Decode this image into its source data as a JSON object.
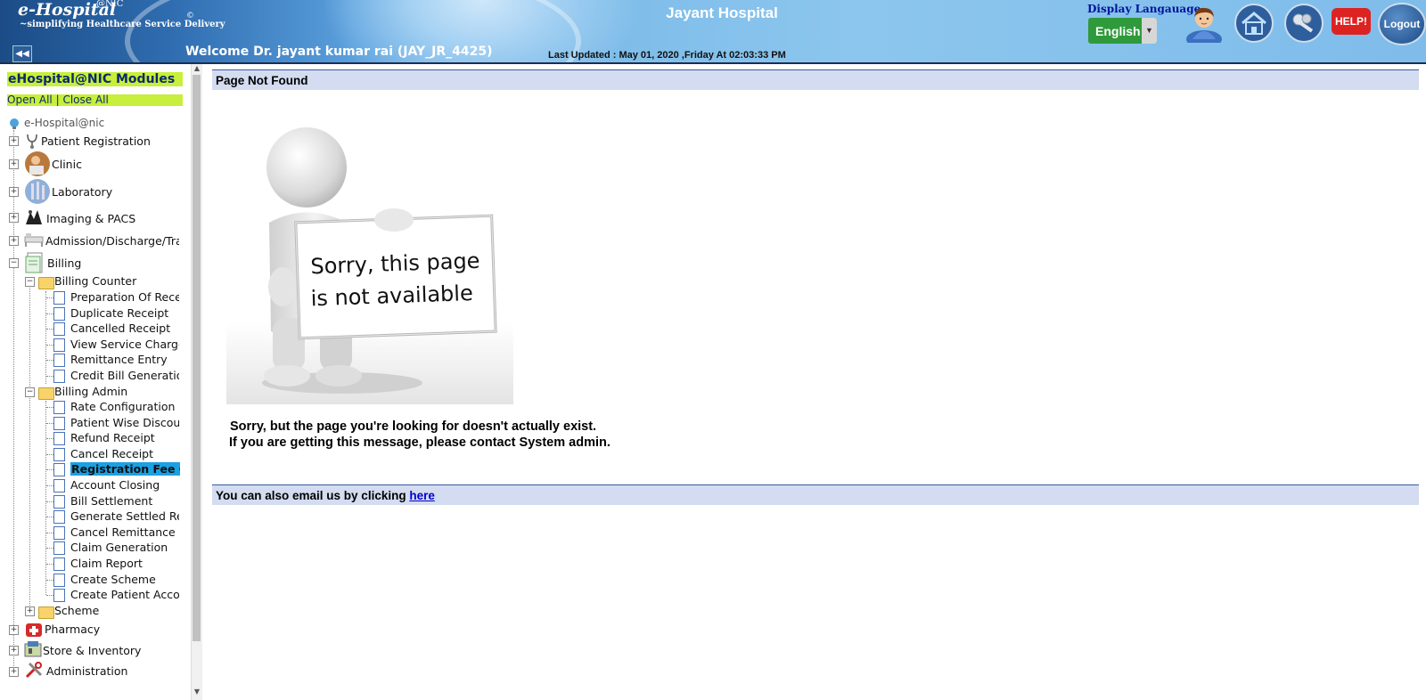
{
  "header": {
    "brand": "e-Hospital",
    "brand_sup": "@NIC",
    "brand_copyright": "©",
    "brand_tagline": "~simplifying Healthcare Service Delivery",
    "hospital_name": "Jayant Hospital",
    "welcome": "Welcome Dr. jayant kumar rai (JAY_JR_4425)",
    "last_updated": "Last Updated : May 01, 2020 ,Friday At 02:03:33 PM",
    "language_label": "Display Langauage",
    "language_value": "English",
    "help_label": "HELP!",
    "logout_label": "Logout",
    "icons": [
      "user-profile-icon",
      "home-icon",
      "keys-icon",
      "help-icon",
      "logout-icon"
    ]
  },
  "sidebar": {
    "title": "eHospital@NIC Modules",
    "open_all": "Open All",
    "separator": "|",
    "close_all": "Close All",
    "root": "e-Hospital@nic",
    "modules": [
      {
        "label": "Patient Registration",
        "icon": "stethoscope-icon"
      },
      {
        "label": "Clinic",
        "icon": "doctor-icon"
      },
      {
        "label": "Laboratory",
        "icon": "lab-icon"
      },
      {
        "label": "Imaging & PACS",
        "icon": "xray-icon"
      },
      {
        "label": "Admission/Discharge/Transfer",
        "icon": "bed-icon"
      },
      {
        "label": "Billing",
        "icon": "billing-icon"
      },
      {
        "label": "Pharmacy",
        "icon": "pharmacy-icon"
      },
      {
        "label": "Store & Inventory",
        "icon": "store-icon"
      },
      {
        "label": "Administration",
        "icon": "tools-icon"
      }
    ],
    "billing_counter": {
      "label": "Billing Counter",
      "items": [
        "Preparation Of Receipt",
        "Duplicate Receipt",
        "Cancelled Receipt",
        "View Service Charge",
        "Remittance Entry",
        "Credit Bill Generation"
      ]
    },
    "billing_admin": {
      "label": "Billing Admin",
      "items": [
        "Rate Configuration of",
        "Patient Wise Discount",
        "Refund Receipt",
        "Cancel Receipt",
        "Registration Fee Ca",
        "Account Closing",
        "Bill Settlement",
        "Generate Settled Rec",
        "Cancel Remittance",
        "Claim Generation",
        "Claim Report",
        "Create Scheme",
        "Create Patient Accoun"
      ],
      "selected_index": 4
    },
    "scheme": "Scheme"
  },
  "main": {
    "title": "Page Not Found",
    "illustration_text_line1": "Sorry, this page",
    "illustration_text_line2": "is not available",
    "message_line1": "Sorry, but the page you're looking for doesn't actually exist.",
    "message_line2": "If you are getting this message, please contact System admin.",
    "email_prefix": "You can also email us by clicking ",
    "email_link": "here"
  },
  "colors": {
    "module_title_bg": "#c7ef3b",
    "selected_item_bg": "#1ba0e2",
    "bar_bg": "#d3dcf0",
    "lang_select_bg": "#2f9a3c",
    "help_bg": "#dd2222"
  }
}
